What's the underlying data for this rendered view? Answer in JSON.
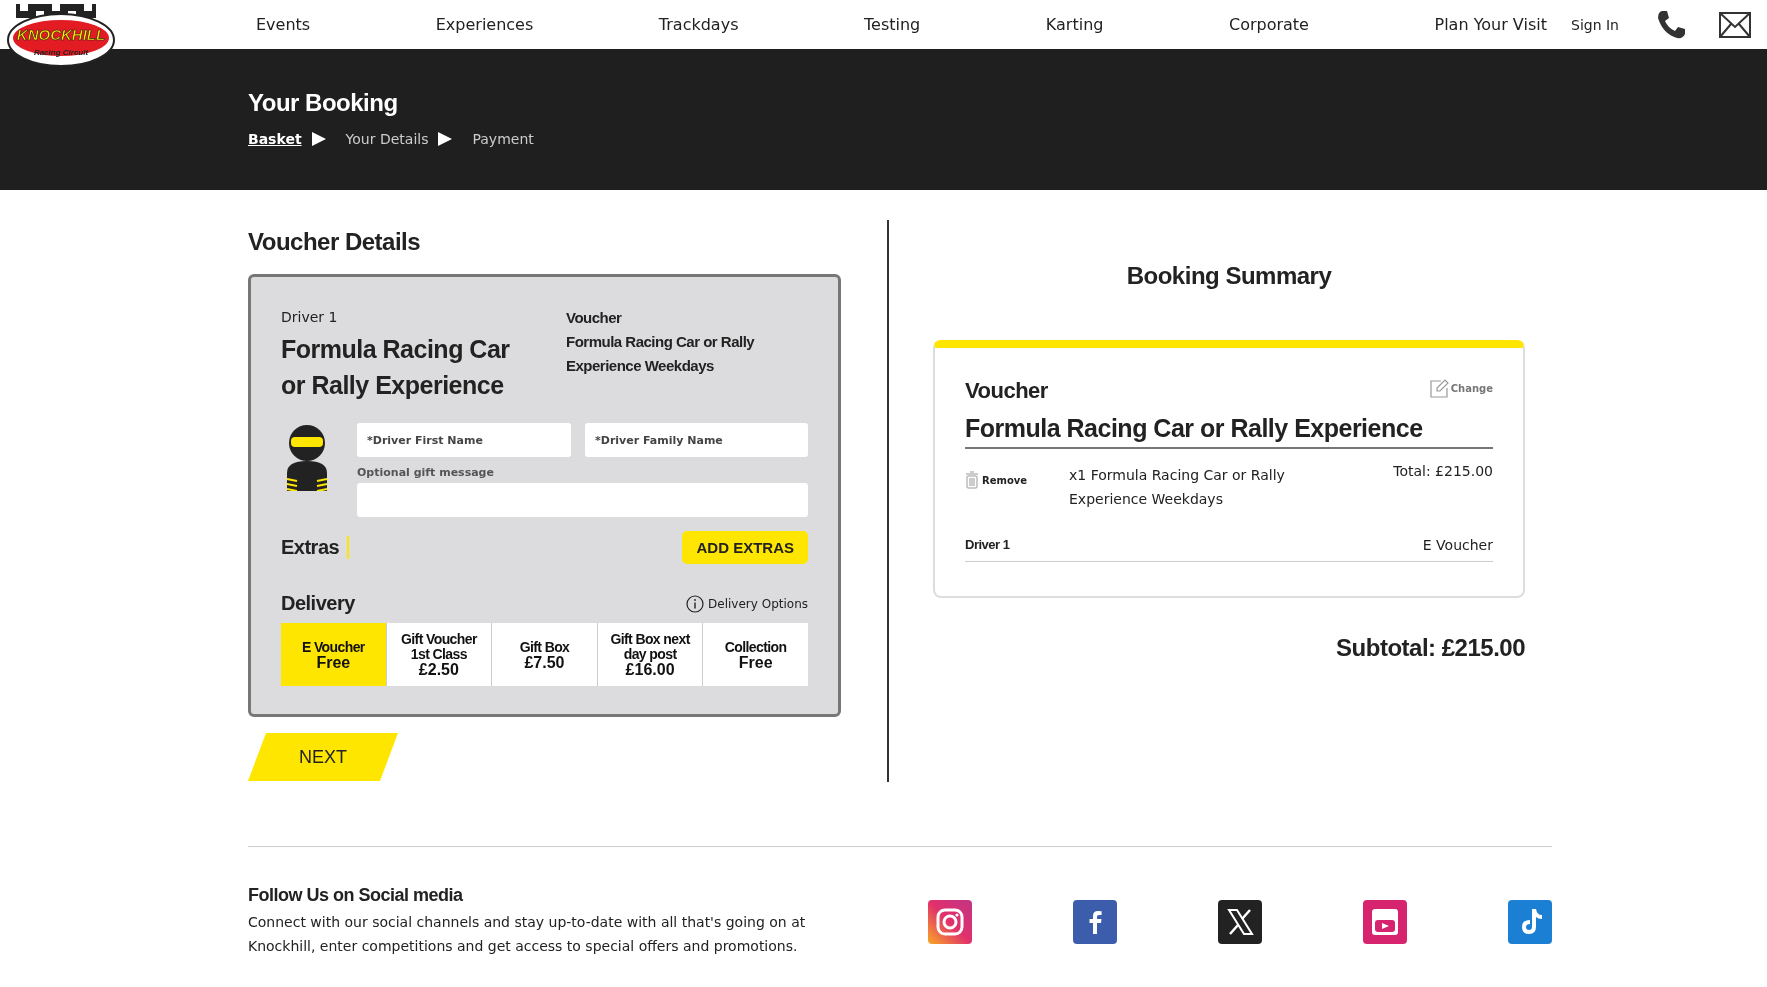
{
  "header": {
    "logo": {
      "name": "KNOCKHILL",
      "tagline": "Racing Circuit"
    },
    "nav": [
      "Events",
      "Experiences",
      "Trackdays",
      "Testing",
      "Karting",
      "Corporate",
      "Plan Your Visit"
    ],
    "sign_in": "Sign In"
  },
  "banner": {
    "title": "Your Booking",
    "steps": [
      {
        "label": "Basket",
        "selected": true
      },
      {
        "label": "Your Details",
        "selected": false
      },
      {
        "label": "Payment",
        "selected": false
      }
    ]
  },
  "voucher_details": {
    "heading": "Voucher Details",
    "driver_label": "Driver 1",
    "product": "Formula Racing Car or Rally Experience",
    "voucher_label": "Voucher",
    "voucher_name": "Formula Racing Car or Rally Experience Weekdays",
    "fields": [
      {
        "placeholder": "*Driver First Name"
      },
      {
        "placeholder": "*Driver Family Name"
      }
    ],
    "gift_message": {
      "label": "Optional gift message"
    },
    "extras": {
      "label": "Extras",
      "button": "ADD EXTRAS"
    },
    "delivery": {
      "label": "Delivery",
      "options_link": "Delivery Options",
      "options": [
        {
          "name": "E Voucher",
          "price": "Free",
          "selected": true
        },
        {
          "name": "Gift Voucher 1st Class",
          "price": "£2.50",
          "selected": false
        },
        {
          "name": "Gift Box",
          "price": "£7.50",
          "selected": false
        },
        {
          "name": "Gift Box next day post",
          "price": "£16.00",
          "selected": false
        },
        {
          "name": "Collection",
          "price": "Free",
          "selected": false
        }
      ]
    },
    "next_button": "NEXT"
  },
  "summary": {
    "heading": "Booking Summary",
    "type": "Voucher",
    "product": "Formula Racing Car or Rally Experience",
    "change": "Change",
    "remove": "Remove",
    "line": "x1 Formula Racing Car or Rally Experience Weekdays",
    "total": "Total: £215.00",
    "driver": "Driver 1",
    "delivery": "E Voucher",
    "subtotal": "Subtotal: £215.00"
  },
  "footer": {
    "heading": "Follow Us on Social media",
    "text": "Connect with our social channels and stay up-to-date with all that's going on at Knockhill, enter competitions and get access to special offers and promotions.",
    "social": [
      {
        "kind": "instagram"
      },
      {
        "kind": "facebook"
      },
      {
        "kind": "x"
      },
      {
        "kind": "youtube"
      },
      {
        "kind": "tiktok"
      }
    ]
  }
}
